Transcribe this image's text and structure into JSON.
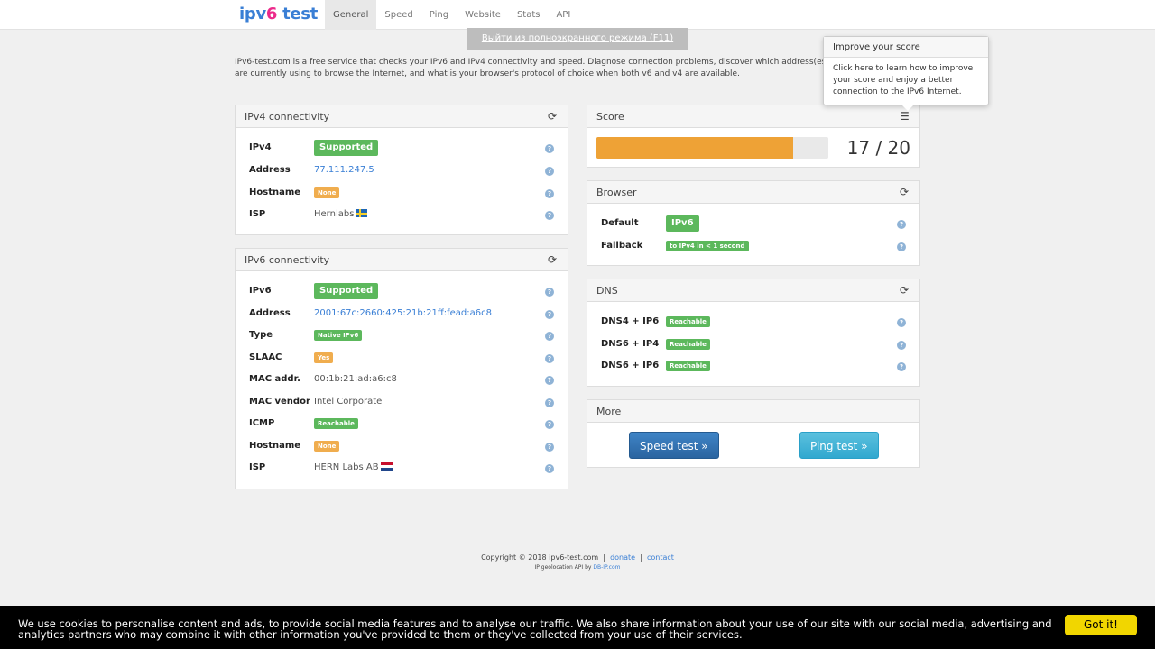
{
  "nav": {
    "logo": {
      "a": "ipv",
      "b": "6",
      "c": " test"
    },
    "tabs": [
      "General",
      "Speed",
      "Ping",
      "Website",
      "Stats",
      "API"
    ],
    "active_tab": "General"
  },
  "toast": "Выйти из полноэкранного режима (F11)",
  "intro": "IPv6-test.com is a free service that checks your IPv6 and IPv4 connectivity and speed. Diagnose connection problems, discover which address(es) you are currently using to browse the Internet, and what is your browser's protocol of choice when both v6 and v4 are available.",
  "ipv4": {
    "title": "IPv4 connectivity",
    "rows": {
      "ipv4": {
        "k": "IPv4",
        "v": "Supported"
      },
      "address": {
        "k": "Address",
        "v": "77.111.247.5"
      },
      "hostname": {
        "k": "Hostname",
        "v": "None"
      },
      "isp": {
        "k": "ISP",
        "v": "Hernlabs"
      }
    }
  },
  "ipv6": {
    "title": "IPv6 connectivity",
    "rows": {
      "ipv6": {
        "k": "IPv6",
        "v": "Supported"
      },
      "address": {
        "k": "Address",
        "v": "2001:67c:2660:425:21b:21ff:fead:a6c8"
      },
      "type": {
        "k": "Type",
        "v": "Native IPv6"
      },
      "slaac": {
        "k": "SLAAC",
        "v": "Yes"
      },
      "mac": {
        "k": "MAC addr.",
        "v": "00:1b:21:ad:a6:c8"
      },
      "vendor": {
        "k": "MAC vendor",
        "v": "Intel Corporate"
      },
      "icmp": {
        "k": "ICMP",
        "v": "Reachable"
      },
      "hostname": {
        "k": "Hostname",
        "v": "None"
      },
      "isp": {
        "k": "ISP",
        "v": "HERN Labs AB"
      }
    }
  },
  "score": {
    "title": "Score",
    "value": 17,
    "max": 20,
    "text": "17 / 20"
  },
  "browser": {
    "title": "Browser",
    "rows": {
      "default": {
        "k": "Default",
        "v": "IPv6"
      },
      "fallback": {
        "k": "Fallback",
        "v": "to IPv4 in < 1 second"
      }
    }
  },
  "dns": {
    "title": "DNS",
    "rows": {
      "d44": {
        "k": "DNS4 + IP6",
        "v": "Reachable"
      },
      "d64": {
        "k": "DNS6 + IP4",
        "v": "Reachable"
      },
      "d66": {
        "k": "DNS6 + IP6",
        "v": "Reachable"
      }
    }
  },
  "more": {
    "title": "More",
    "speed_btn": "Speed test »",
    "ping_btn": "Ping test »"
  },
  "popover": {
    "title": "Improve your score",
    "body": "Click here to learn how to improve your score and enjoy a better connection to the IPv6 Internet."
  },
  "footer": {
    "copyright": "Copyright © 2018 ipv6-test.com",
    "sep": "|",
    "donate": "donate",
    "contact": "contact",
    "geo_prefix": "IP geolocation API by",
    "geo_link": "DB-IP.com"
  },
  "cookie": {
    "message": "We use cookies to personalise content and ads, to provide social media features and to analyse our traffic. We also share information about your use of our site with our social media, advertising and analytics partners who may combine it with other information you've provided to them or they've collected from your use of their services.",
    "button": "Got it!"
  },
  "colors": {
    "score_fill": "#eea236",
    "green": "#5cb85c",
    "orange": "#f0ad4e",
    "link": "#3a7fd5"
  }
}
